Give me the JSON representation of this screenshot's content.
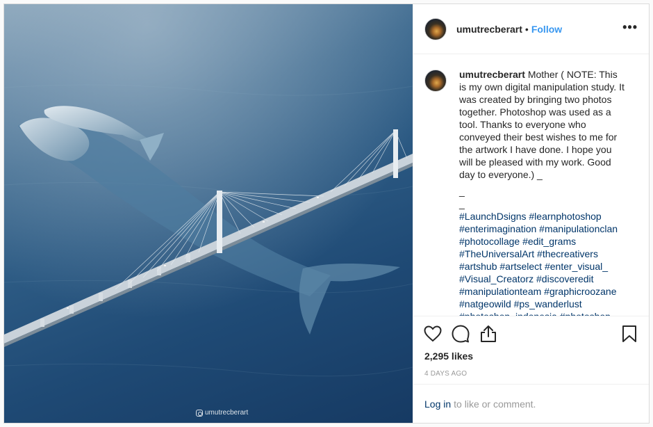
{
  "post": {
    "username": "umutrecberart",
    "separator": "•",
    "follow_label": "Follow",
    "more_label": "•••",
    "watermark": "umutrecberart",
    "caption": {
      "username": "umutrecberart",
      "text": "Mother ( NOTE: This is my own digital manipulation study. It was created by bringing two photos together. Photoshop was used as a tool. Thanks to everyone who conveyed their best wishes to me for the artwork I have done. I hope you will be pleased with my work. Good day to everyone.) _",
      "underscore_lines": [
        "_",
        "_"
      ],
      "hashtags": [
        "#LaunchDsigns #learnphotoshop",
        "#enterimagination #manipulationclan",
        "#photocollage #edit_grams",
        "#TheUniversalArt #thecreativers",
        "#artshub #artselect #enter_visual_",
        "#Visual_Creatorz #discoveredit",
        "#manipulationteam #graphicroozane",
        "#natgeowild #ps_wanderlust",
        "#photoshop_indonesia #photoshop"
      ]
    },
    "likes": "2,295 likes",
    "age": "4 DAYS AGO",
    "login": {
      "link": "Log in",
      "text": "to like or comment."
    }
  },
  "icons": {
    "like": "heart-icon",
    "comment": "comment-bubble-icon",
    "share": "share-icon",
    "save": "bookmark-icon",
    "more": "more-options-icon"
  },
  "colors": {
    "follow": "#3897f0",
    "hashtag": "#003569",
    "muted": "#999999",
    "border": "#dbdbdb"
  }
}
